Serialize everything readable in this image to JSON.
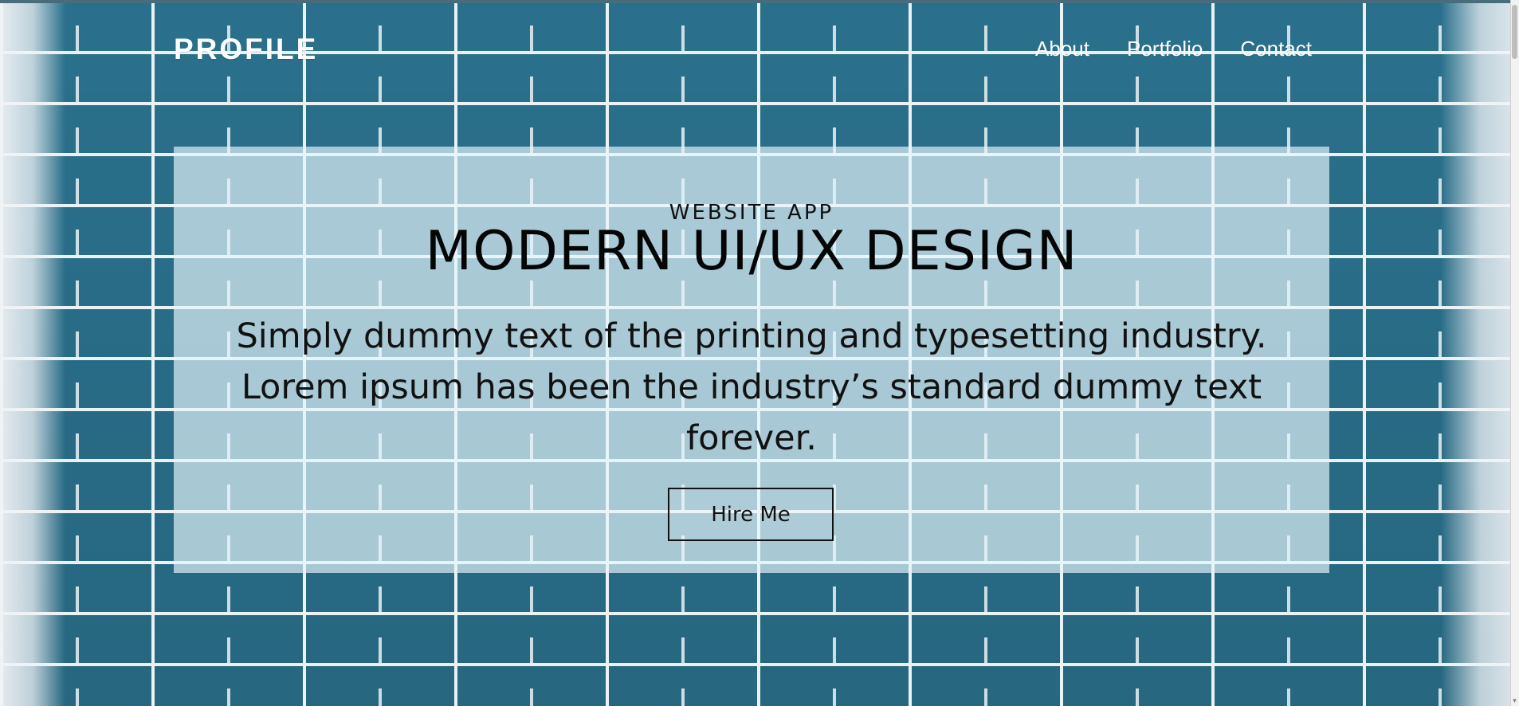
{
  "header": {
    "logo": "PROFILE",
    "nav": [
      {
        "label": "About"
      },
      {
        "label": "Portfolio"
      },
      {
        "label": "Contact"
      }
    ]
  },
  "hero": {
    "eyebrow": "WEBSITE APP",
    "title": "MODERN UI/UX DESIGN",
    "body": "Simply dummy text of the printing and typesetting industry. Lorem ipsum has been the industry’s standard dummy text forever.",
    "button_label": "Hire Me"
  },
  "scrollbar": {
    "arrow": "▾"
  },
  "colors": {
    "wall_blue": "#2f7d9c",
    "panel": "#e6f5fa",
    "text": "#111111",
    "nav_text": "#ffffff"
  }
}
